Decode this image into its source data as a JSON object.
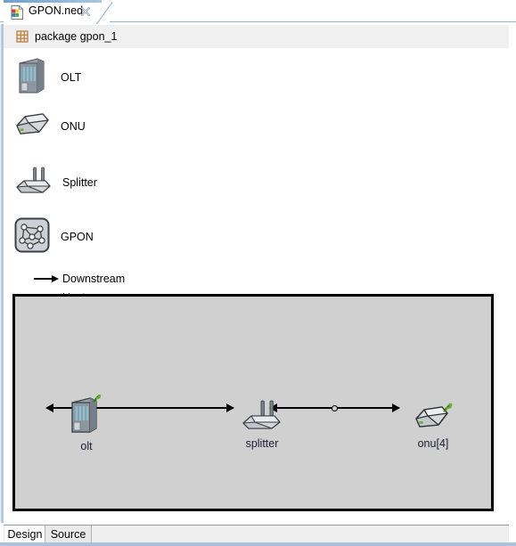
{
  "window": {
    "title": "GPON.ned"
  },
  "editor_tab": {
    "label": "GPON.ned",
    "icon": "ned-file-icon",
    "close_icon": "close-icon",
    "active": true
  },
  "package_bar": {
    "icon": "package-grid-icon",
    "text": "package gpon_1"
  },
  "palette": {
    "items": [
      {
        "label": "OLT",
        "icon": "olt-server-icon"
      },
      {
        "label": "ONU",
        "icon": "onu-box-icon"
      },
      {
        "label": "Splitter",
        "icon": "splitter-antenna-icon"
      },
      {
        "label": "GPON",
        "icon": "gpon-network-icon"
      }
    ],
    "connections": [
      {
        "label": "Downstream",
        "icon": "arrow-right-icon"
      },
      {
        "label": "Upstream",
        "icon": "arrow-right-icon"
      }
    ]
  },
  "canvas": {
    "background_color": "#d0d0d0",
    "border_color": "#000000",
    "nodes": [
      {
        "name": "olt",
        "label": "olt",
        "icon": "olt-server-icon",
        "has_gate_pin": true
      },
      {
        "name": "splitter",
        "label": "splitter",
        "icon": "splitter-antenna-icon",
        "has_gate_pin": false
      },
      {
        "name": "onu",
        "label": "onu[4]",
        "icon": "onu-box-icon",
        "has_gate_pin": true
      }
    ],
    "connections": [
      {
        "from": "olt",
        "to": "splitter",
        "style": "bidirectional-arrow",
        "has_midpoint_handle": false
      },
      {
        "from": "splitter",
        "to": "onu",
        "style": "bidirectional-arrow",
        "has_midpoint_handle": true
      }
    ]
  },
  "bottom_tabs": [
    {
      "label": "Design",
      "active": true
    },
    {
      "label": "Source",
      "active": false
    }
  ],
  "colors": {
    "tab_accent": "#6f9fd0",
    "frame_blue": "#aac2da",
    "canvas_bg": "#d0d0d0",
    "package_bar_bg": "#f0f0f0",
    "node_label": "#1a1a3a"
  }
}
